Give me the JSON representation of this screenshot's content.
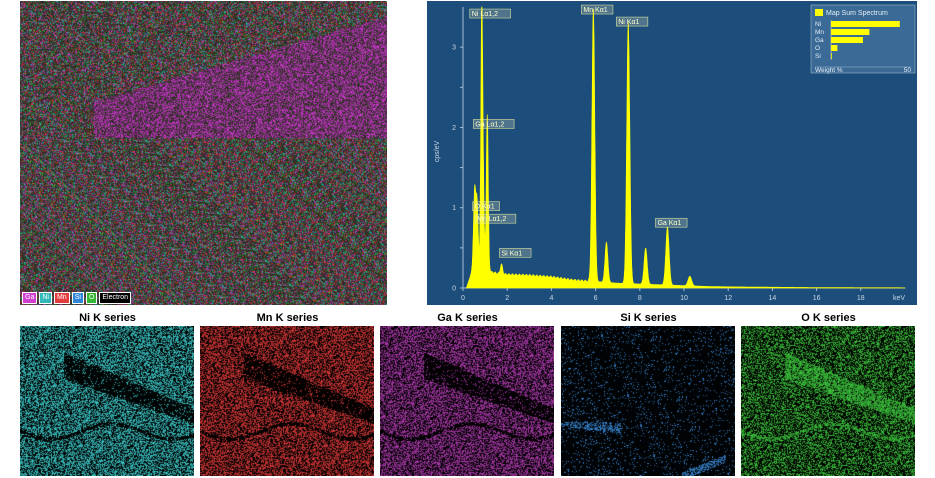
{
  "composite": {
    "legend": [
      {
        "label": "Ga",
        "color": "#d13fd1"
      },
      {
        "label": "Ni",
        "color": "#31b8b8"
      },
      {
        "label": "Mn",
        "color": "#e23c3c"
      },
      {
        "label": "Si",
        "color": "#2f86d9"
      },
      {
        "label": "O",
        "color": "#35b735"
      },
      {
        "label": "Electron",
        "color": "#000000"
      }
    ]
  },
  "maps": [
    {
      "title": "Ni K series",
      "color": "#3fd3d3"
    },
    {
      "title": "Mn K series",
      "color": "#e03a3a"
    },
    {
      "title": "Ga K series",
      "color": "#b43cb4"
    },
    {
      "title": "Si K series",
      "color": "#3b8fe0"
    },
    {
      "title": "O K series",
      "color": "#3fcf3f"
    }
  ],
  "chart_data": {
    "type": "line",
    "xlabel": "keV",
    "ylabel": "cps/eV",
    "xlim": [
      0,
      20
    ],
    "ylim": [
      0,
      3.5
    ],
    "xticks": [
      0,
      2,
      4,
      6,
      8,
      10,
      12,
      14,
      16,
      18
    ],
    "yticks": [
      0,
      0.5,
      1,
      1.5,
      2,
      2.5,
      3
    ],
    "ytick_labels": [
      "0",
      "",
      "1",
      "",
      "2",
      "",
      "3"
    ],
    "background": "#1d4e7b",
    "series_color": "#ffff00",
    "peaks": [
      {
        "x": 0.525,
        "y": 0.95,
        "w": 0.05
      },
      {
        "x": 0.637,
        "y": 0.82,
        "w": 0.05
      },
      {
        "x": 0.851,
        "y": 3.35,
        "w": 0.045
      },
      {
        "x": 0.935,
        "y": 0.6,
        "w": 0.04
      },
      {
        "x": 1.098,
        "y": 1.95,
        "w": 0.045
      },
      {
        "x": 1.74,
        "y": 0.12,
        "w": 0.05
      },
      {
        "x": 5.899,
        "y": 3.4,
        "w": 0.065
      },
      {
        "x": 6.49,
        "y": 0.5,
        "w": 0.065
      },
      {
        "x": 7.478,
        "y": 3.25,
        "w": 0.07
      },
      {
        "x": 8.265,
        "y": 0.45,
        "w": 0.07
      },
      {
        "x": 9.251,
        "y": 0.72,
        "w": 0.075
      },
      {
        "x": 10.264,
        "y": 0.12,
        "w": 0.08
      }
    ],
    "background_curve": [
      [
        0.15,
        0.0
      ],
      [
        0.3,
        0.12
      ],
      [
        0.45,
        0.26
      ],
      [
        1.3,
        0.2
      ],
      [
        1.6,
        0.18
      ],
      [
        2.0,
        0.17
      ],
      [
        3.0,
        0.16
      ],
      [
        4.0,
        0.14
      ],
      [
        5.0,
        0.1
      ],
      [
        6.0,
        0.08
      ],
      [
        7.0,
        0.06
      ],
      [
        8.0,
        0.05
      ],
      [
        9.0,
        0.04
      ],
      [
        10.0,
        0.03
      ],
      [
        11.0,
        0.02
      ],
      [
        12.0,
        0.015
      ],
      [
        14.0,
        0.01
      ],
      [
        16.0,
        0.006
      ],
      [
        18.0,
        0.004
      ],
      [
        20.0,
        0.003
      ]
    ],
    "annotations": [
      {
        "text": "Ni Lα1,2",
        "x": 0.851,
        "y": 3.35
      },
      {
        "text": "Mn Kα1",
        "x": 5.899,
        "y": 3.4
      },
      {
        "text": "Ni Kα1",
        "x": 7.478,
        "y": 3.25
      },
      {
        "text": "Ga Lα1,2",
        "x": 1.098,
        "y": 1.95
      },
      {
        "text": "O Kα1",
        "x": 0.525,
        "y": 0.95
      },
      {
        "text": "Mn Lα1,2",
        "x": 0.637,
        "y": 0.82
      },
      {
        "text": "Si Kα1",
        "x": 1.74,
        "y": 0.12
      },
      {
        "text": "Ga Kα1",
        "x": 9.251,
        "y": 0.72
      }
    ],
    "inset": {
      "title": "Map Sum Spectrum",
      "xlabel": "Weight %",
      "xmax": 50,
      "bars": [
        {
          "label": "Ni",
          "value": 43
        },
        {
          "label": "Mn",
          "value": 24
        },
        {
          "label": "Ga",
          "value": 20
        },
        {
          "label": "O",
          "value": 4
        },
        {
          "label": "Si",
          "value": 0.3
        }
      ]
    }
  }
}
